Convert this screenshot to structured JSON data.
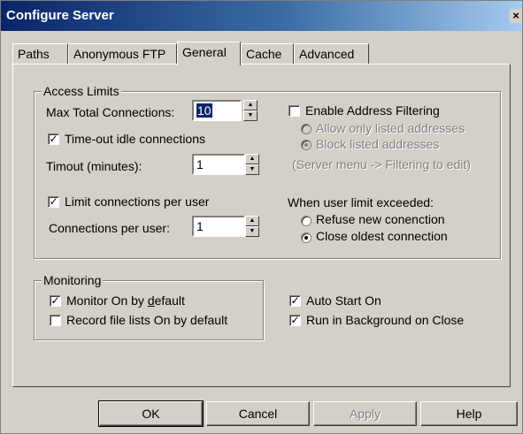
{
  "window": {
    "title": "Configure Server",
    "close_glyph": "×"
  },
  "tabs": [
    {
      "label": "Paths",
      "active": false
    },
    {
      "label": "Anonymous FTP",
      "active": false
    },
    {
      "label": "General",
      "active": true
    },
    {
      "label": "Cache",
      "active": false
    },
    {
      "label": "Advanced",
      "active": false
    }
  ],
  "access_limits": {
    "title": "Access Limits",
    "max_total_connections_label": "Max Total Connections:",
    "max_total_connections_value": "10",
    "timeout_idle_label": "Time-out idle connections",
    "timeout_idle_checked": true,
    "timeout_minutes_label": "Timout (minutes):",
    "timeout_minutes_value": "1",
    "limit_per_user_label": "Limit connections per user",
    "limit_per_user_checked": true,
    "connections_per_user_label": "Connections per user:",
    "connections_per_user_value": "1",
    "enable_address_filtering_label": "Enable Address Filtering",
    "enable_address_filtering_checked": false,
    "allow_listed_label": "Allow only listed addresses",
    "allow_listed_selected": false,
    "block_listed_label": "Block listed addresses",
    "block_listed_selected": true,
    "filtering_hint": "(Server menu -> Filtering to edit)",
    "user_limit_exceeded_label": "When user limit exceeded:",
    "refuse_new_label": "Refuse new conenction",
    "refuse_new_selected": false,
    "close_oldest_label": "Close oldest connection",
    "close_oldest_selected": true
  },
  "monitoring": {
    "title": "Monitoring",
    "monitor_on_prefix": "Monitor On by ",
    "monitor_on_accel": "d",
    "monitor_on_suffix": "efault",
    "monitor_on_checked": true,
    "record_file_lists_label": "Record file lists On by default",
    "record_file_lists_checked": false
  },
  "auto_start": {
    "label": "Auto Start On",
    "checked": true
  },
  "run_background": {
    "label": "Run in Background on Close",
    "checked": true
  },
  "buttons": {
    "ok": "OK",
    "cancel": "Cancel",
    "apply": "Apply",
    "help": "Help"
  },
  "glyphs": {
    "check": "✓",
    "spin_up": "▲",
    "spin_down": "▼"
  }
}
